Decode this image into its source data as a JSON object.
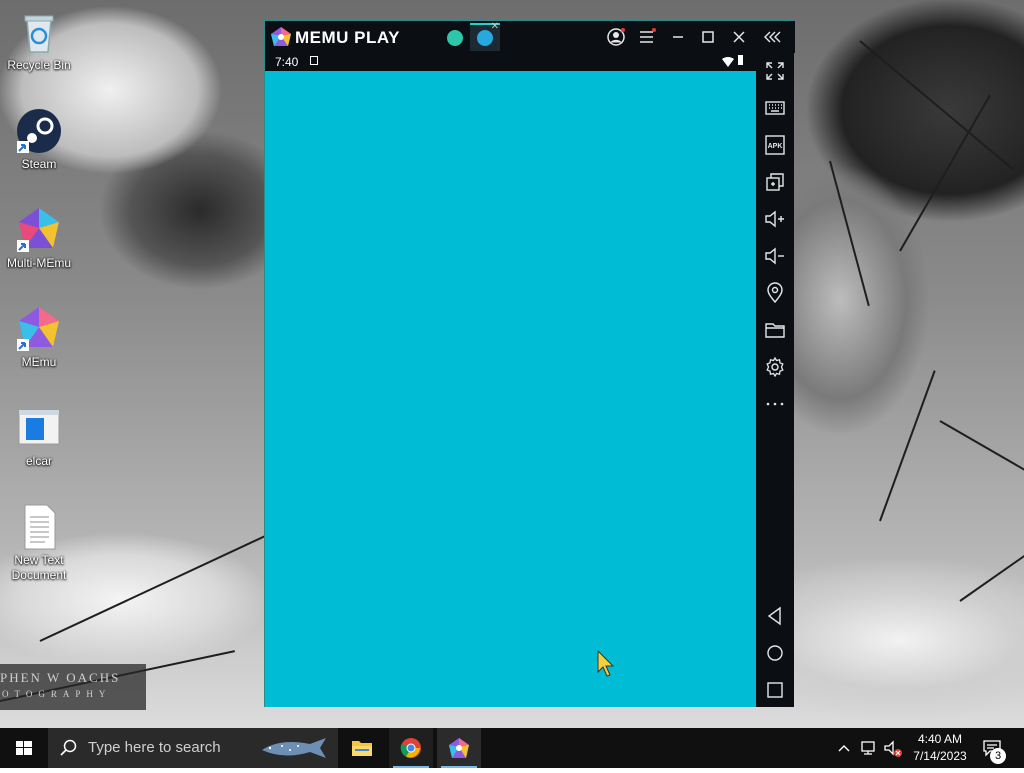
{
  "desktop": {
    "icons": [
      {
        "label": "Recycle Bin",
        "icon": "recycle-bin-icon"
      },
      {
        "label": "Steam",
        "icon": "steam-icon"
      },
      {
        "label": "Multi-MEmu",
        "icon": "multi-memu-icon"
      },
      {
        "label": "MEmu",
        "icon": "memu-icon"
      },
      {
        "label": "elcar",
        "icon": "elcar-file-icon"
      },
      {
        "label": "New Text Document",
        "icon": "text-document-icon"
      }
    ],
    "watermark": {
      "line1": "PHEN W OACHS",
      "line2": "OTOGRAPHY"
    }
  },
  "memu": {
    "brand": "MEMU PLAY",
    "status_time": "7:40",
    "screen_color": "#00bcd4",
    "tabs": [
      {
        "icon": "android-home-tab-icon",
        "active": false
      },
      {
        "icon": "app-tab-icon",
        "active": true
      }
    ],
    "title_buttons": [
      "account-icon",
      "menu-icon",
      "minimize-icon",
      "maximize-icon",
      "close-icon",
      "collapse-sidebar-icon"
    ],
    "sidebar_buttons": [
      "fullscreen-icon",
      "keyboard-icon",
      "apk-icon",
      "multi-window-icon",
      "volume-up-icon",
      "volume-down-icon",
      "location-icon",
      "folder-icon",
      "settings-icon",
      "more-icon"
    ],
    "nav_buttons": [
      "back-icon",
      "home-icon",
      "recents-icon"
    ]
  },
  "taskbar": {
    "search_placeholder": "Type here to search",
    "apps": [
      "file-explorer-icon",
      "chrome-icon",
      "memu-taskbar-icon"
    ],
    "time": "4:40 AM",
    "date": "7/14/2023",
    "notification_count": "3"
  }
}
